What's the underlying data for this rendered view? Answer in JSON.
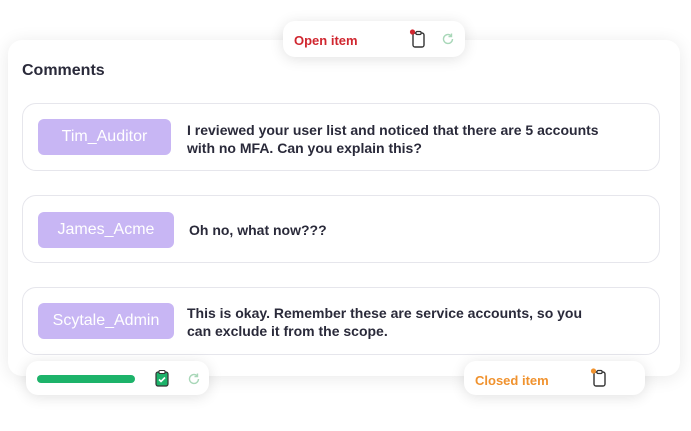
{
  "comments_title": "Comments",
  "comments": [
    {
      "author": "Tim_Auditor",
      "text_line1": "I reviewed your user list and noticed that there are 5 accounts",
      "text_line2": "with no MFA. Can you explain this?"
    },
    {
      "author": "James_Acme",
      "text_line1": "Oh no, what now???",
      "text_line2": ""
    },
    {
      "author": "Scytale_Admin",
      "text_line1": "This is okay. Remember these are service accounts, so you",
      "text_line2": "can exclude it from the scope."
    }
  ],
  "open_item": {
    "label": "Open item",
    "icons": [
      "clipboard-icon",
      "refresh-icon"
    ],
    "dot_color": "#d0262f"
  },
  "closed_item": {
    "label": "Closed item",
    "icons": [
      "clipboard-icon"
    ],
    "dot_color": "#f0922e"
  },
  "progress": {
    "value": 1.0,
    "color": "#1db36a",
    "icons": [
      "clipboard-check-icon",
      "refresh-icon"
    ]
  }
}
